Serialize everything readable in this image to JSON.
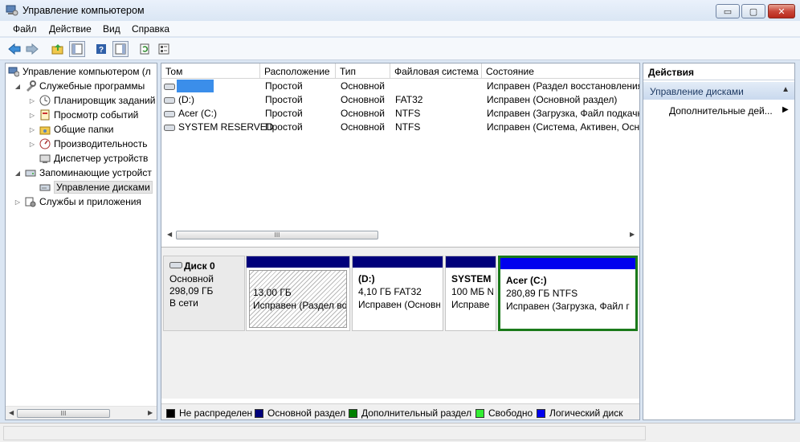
{
  "window": {
    "title": "Управление компьютером",
    "minimize": "▭",
    "maximize": "▢",
    "close": "✕"
  },
  "menu": [
    "Файл",
    "Действие",
    "Вид",
    "Справка"
  ],
  "toolbar": {
    "icons": [
      "back-arrow-icon",
      "forward-arrow-icon",
      "up-folder-icon",
      "show-hide-tree-icon",
      "help-icon",
      "show-hide-action-icon",
      "refresh-icon",
      "properties-icon"
    ]
  },
  "tree": {
    "items": [
      {
        "label": "Управление компьютером (л",
        "arrow": "",
        "icon": "computer-management-icon"
      },
      {
        "label": "Служебные программы",
        "arrow": "◢",
        "icon": "tools-icon"
      },
      {
        "label": "Планировщик заданий",
        "arrow": "▷",
        "icon": "task-scheduler-icon"
      },
      {
        "label": "Просмотр событий",
        "arrow": "▷",
        "icon": "event-viewer-icon"
      },
      {
        "label": "Общие папки",
        "arrow": "▷",
        "icon": "shared-folders-icon"
      },
      {
        "label": "Производительность",
        "arrow": "▷",
        "icon": "performance-icon"
      },
      {
        "label": "Диспетчер устройств",
        "arrow": "",
        "icon": "device-manager-icon"
      },
      {
        "label": "Запоминающие устройст",
        "arrow": "◢",
        "icon": "storage-icon"
      },
      {
        "label": "Управление дисками",
        "arrow": "",
        "icon": "disk-management-icon"
      },
      {
        "label": "Службы и приложения",
        "arrow": "▷",
        "icon": "services-icon"
      }
    ],
    "scroll_thumb": "III"
  },
  "volumes": {
    "columns": [
      "Том",
      "Расположение",
      "Тип",
      "Файловая система",
      "Состояние"
    ],
    "rows": [
      {
        "name": "",
        "layout": "Простой",
        "type": "Основной",
        "fs": "",
        "status": "Исправен (Раздел восстановления"
      },
      {
        "name": "(D:)",
        "layout": "Простой",
        "type": "Основной",
        "fs": "FAT32",
        "status": "Исправен (Основной раздел)"
      },
      {
        "name": "Acer (C:)",
        "layout": "Простой",
        "type": "Основной",
        "fs": "NTFS",
        "status": "Исправен (Загрузка, Файл подкачк"
      },
      {
        "name": "SYSTEM RESERVED",
        "layout": "Простой",
        "type": "Основной",
        "fs": "NTFS",
        "status": "Исправен (Система, Активен, Осно"
      }
    ],
    "scroll_thumb": "III"
  },
  "disk": {
    "name": "Диск 0",
    "type": "Основной",
    "size": "298,09 ГБ",
    "status": "В сети",
    "partitions": [
      {
        "name": "",
        "size": "13,00 ГБ",
        "status": "Исправен (Раздел вос",
        "bar_color": "#00007b"
      },
      {
        "name": "(D:)",
        "size": "4,10 ГБ FAT32",
        "status": "Исправен (Основн",
        "bar_color": "#00007b"
      },
      {
        "name": "SYSTEM",
        "size": "100 МБ N",
        "status": "Исправе",
        "bar_color": "#00007b"
      },
      {
        "name": "Acer  (C:)",
        "size": "280,89 ГБ NTFS",
        "status": "Исправен (Загрузка, Файл г",
        "bar_color": "#0000ee"
      }
    ]
  },
  "legend": [
    {
      "label": "Не распределен",
      "color": "#000000"
    },
    {
      "label": "Основной раздел",
      "color": "#00007b"
    },
    {
      "label": "Дополнительный раздел",
      "color": "#008000"
    },
    {
      "label": "Свободно",
      "color": "#33ee33"
    },
    {
      "label": "Логический диск",
      "color": "#0000ee"
    }
  ],
  "actions": {
    "title": "Действия",
    "section": "Управление дисками",
    "more": "Дополнительные дей..."
  }
}
